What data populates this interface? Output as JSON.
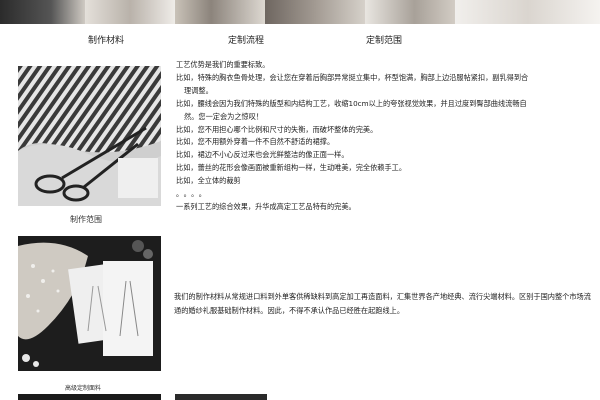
{
  "banner": {
    "colors": [
      "#2b2b2b",
      "#d8d3cc",
      "#bfb7ad",
      "#6e6660",
      "#9a938c",
      "#e7e3de"
    ]
  },
  "tabs": [
    "制作材料",
    "定制流程",
    "定制范围"
  ],
  "section1": {
    "caption": "制作范围",
    "lines": [
      "工艺优势是我们的重要标致。",
      "比如，特殊的胸衣鱼骨处理，会让您在穿着后胸部异常挺立集中，杯型饱满，胸部上边沿服帖紧扣，副乳得到合",
      "理调整。",
      "比如，腰线会因为我们特殊的版型和内结构工艺，收缩10cm以上的夸张视觉效果，并且过度到臀部曲线流畅自",
      "然。您一定会为之惊叹！",
      "比如，您不用担心哪个比例和尺寸的失衡，而破坏整体的完美。",
      "比如，您不用额外穿着一件不自然不舒适的裙撑。",
      "比如，裙边不小心反过来也会光鲜整洁的像正面一样。",
      "比如，蕾丝的花形会像画面被重新组构一样，生动唯美，完全依赖手工。",
      "比如，全立体的裁剪",
      "。。。。",
      "一系列工艺的综合效果，升华成高定工艺品特有的完美。"
    ]
  },
  "section2": {
    "caption": "高级定制面料",
    "text": "我们的制作材料从常规进口料到外单客供稀缺料到高定加工再造面料，汇集世界各产地经典、流行尖端材料。区别于国内整个市场流通的婚纱礼服基础制作材料。因此，不得不承认作品已经胜在起跑线上。"
  }
}
